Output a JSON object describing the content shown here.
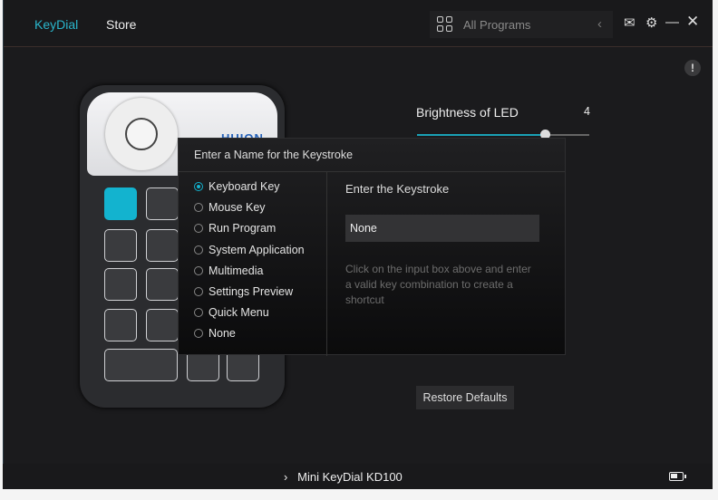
{
  "header": {
    "tabs": [
      {
        "label": "KeyDial",
        "active": true
      },
      {
        "label": "Store",
        "active": false
      }
    ],
    "program_selector": "All Programs"
  },
  "device": {
    "brand": "HUION"
  },
  "led": {
    "label": "Brightness of LED",
    "value": "4",
    "min": 1,
    "max": 5,
    "current": 4
  },
  "dialog": {
    "title": "Enter a Name for the Keystroke",
    "options": [
      "Keyboard Key",
      "Mouse Key",
      "Run Program",
      "System Application",
      "Multimedia",
      "Settings Preview",
      "Quick Menu",
      "None"
    ],
    "selected_index": 0,
    "keystroke_label": "Enter the Keystroke",
    "keystroke_value": "None",
    "hint": "Click on the input box above and enter a valid key combination to create a shortcut"
  },
  "restore_label": "Restore Defaults",
  "footer": {
    "device_name": "Mini KeyDial KD100"
  },
  "colors": {
    "accent": "#13b3cf",
    "bg": "#1b1b1d"
  }
}
